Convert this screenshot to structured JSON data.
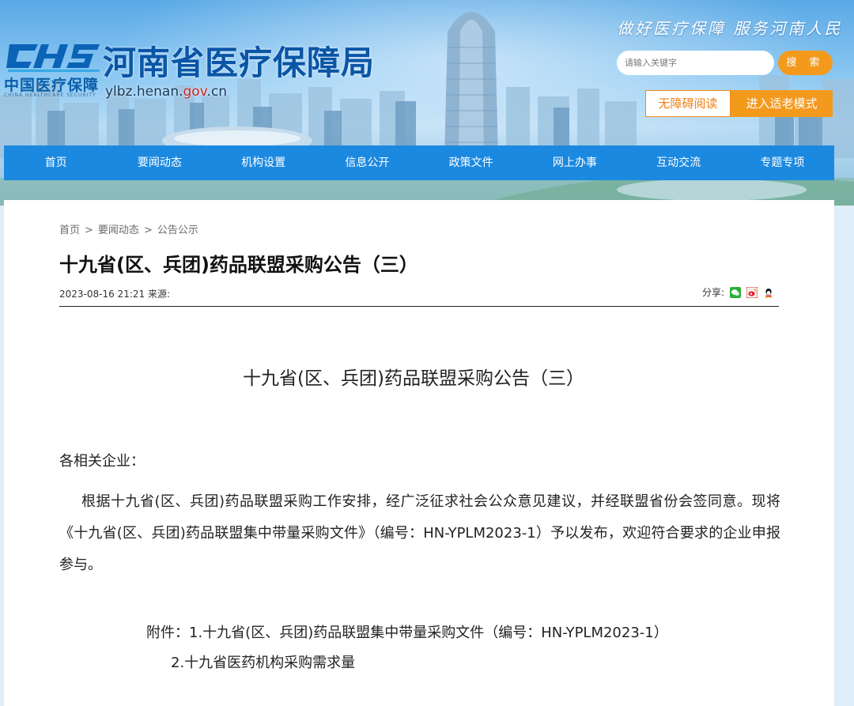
{
  "header": {
    "logo_letters": "CHS",
    "logo_cn": "中国医疗保障",
    "logo_en": "CHINA HEALTHCARE SECURITY",
    "site_title": "河南省医疗保障局",
    "domain_prefix": "ylbz.henan.",
    "domain_gov": "gov",
    "domain_suffix": ".cn",
    "slogan": "做好医疗保障  服务河南人民",
    "search_placeholder": "请输入关键字",
    "search_button": "搜 索",
    "accessibility_button": "无障碍阅读",
    "elder_mode_button": "进入适老模式"
  },
  "nav": {
    "items": [
      {
        "label": "首页"
      },
      {
        "label": "要闻动态"
      },
      {
        "label": "机构设置"
      },
      {
        "label": "信息公开"
      },
      {
        "label": "政策文件"
      },
      {
        "label": "网上办事"
      },
      {
        "label": "互动交流"
      },
      {
        "label": "专题专项"
      }
    ]
  },
  "breadcrumb": {
    "home": "首页",
    "level1": "要闻动态",
    "level2": "公告公示",
    "separator": ">"
  },
  "article": {
    "title": "十九省(区、兵团)药品联盟采购公告（三）",
    "date": "2023-08-16 21:21",
    "source_label": "来源:",
    "share_label": "分享:",
    "share_icons": [
      "wechat-icon",
      "weibo-icon",
      "qq-icon"
    ],
    "doc_title": "十九省(区、兵团)药品联盟采购公告（三）",
    "salutation": "各相关企业：",
    "body": "根据十九省(区、兵团)药品联盟采购工作安排，经广泛征求社会公众意见建议，并经联盟省份会签同意。现将《十九省(区、兵团)药品联盟集中带量采购文件》（编号：HN-YPLM2023-1）予以发布，欢迎符合要求的企业申报参与。",
    "attachment_1": "附件：1.十九省(区、兵团)药品联盟集中带量采购文件（编号：HN-YPLM2023-1）",
    "attachment_2": "2.十九省医药机构采购需求量"
  },
  "colors": {
    "nav_bg": "#1c89e0",
    "accent_orange": "#f39a1d",
    "title_blue": "#0a55a6"
  }
}
